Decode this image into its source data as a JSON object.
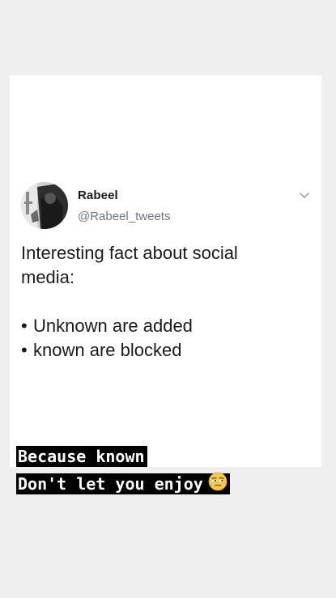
{
  "tweet": {
    "display_name": "Rabeel",
    "handle": "@Rabeel_tweets",
    "text_lines": [
      "Interesting fact about social",
      "media:"
    ],
    "bullets": [
      "Unknown are added",
      "known are blocked"
    ],
    "bullet_char": "•",
    "menu_icon": "chevron-down-icon",
    "avatar": "profile-photo"
  },
  "captions": {
    "line1": "Because known",
    "line2": "Don't let you enjoy",
    "emoji": "unamused-face-emoji"
  },
  "colors": {
    "background": "#efefef",
    "card": "#ffffff",
    "handle": "#6c7680",
    "caption_bg": "#000000",
    "caption_text": "#ffffff"
  }
}
